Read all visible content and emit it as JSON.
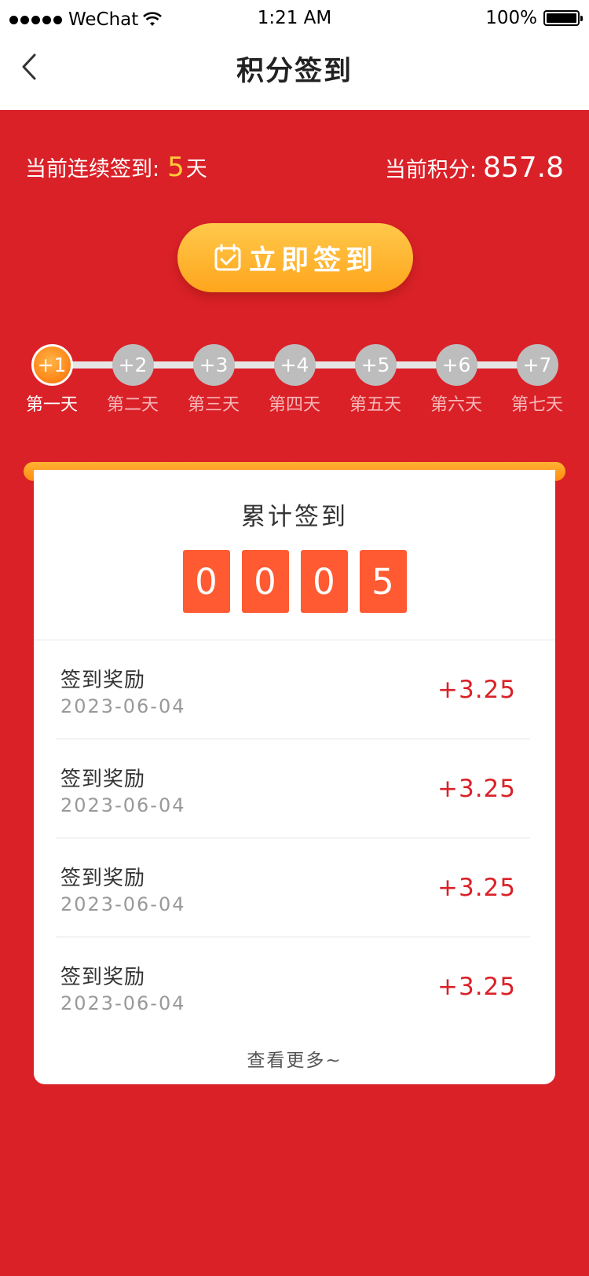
{
  "status_bar": {
    "carrier": "WeChat",
    "time": "1:21 AM",
    "battery": "100%"
  },
  "nav": {
    "title": "积分签到",
    "back_icon": "chevron-left-icon"
  },
  "stats": {
    "streak_label": "当前连续签到:",
    "streak_value": "5",
    "streak_unit": "天",
    "points_label": "当前积分:",
    "points_value": "857.8"
  },
  "sign_button": {
    "label": "立即签到",
    "icon": "calendar-check-icon"
  },
  "progress": {
    "active_day": 1,
    "days": [
      {
        "bonus": "+1",
        "label": "第一天"
      },
      {
        "bonus": "+2",
        "label": "第二天"
      },
      {
        "bonus": "+3",
        "label": "第三天"
      },
      {
        "bonus": "+4",
        "label": "第四天"
      },
      {
        "bonus": "+5",
        "label": "第五天"
      },
      {
        "bonus": "+6",
        "label": "第六天"
      },
      {
        "bonus": "+7",
        "label": "第七天"
      }
    ]
  },
  "card": {
    "title": "累计签到",
    "digits": [
      "0",
      "0",
      "0",
      "5"
    ],
    "records": [
      {
        "title": "签到奖励",
        "date": "2023-06-04",
        "amount": "+3.25"
      },
      {
        "title": "签到奖励",
        "date": "2023-06-04",
        "amount": "+3.25"
      },
      {
        "title": "签到奖励",
        "date": "2023-06-04",
        "amount": "+3.25"
      },
      {
        "title": "签到奖励",
        "date": "2023-06-04",
        "amount": "+3.25"
      }
    ],
    "more_label": "查看更多~"
  },
  "colors": {
    "background": "#DA2128",
    "accent_yellow": "#FFCB3A",
    "button_orange": "#FFA51D",
    "digit_bg": "#FF5A31",
    "inactive_circle": "#BDBDBD"
  }
}
